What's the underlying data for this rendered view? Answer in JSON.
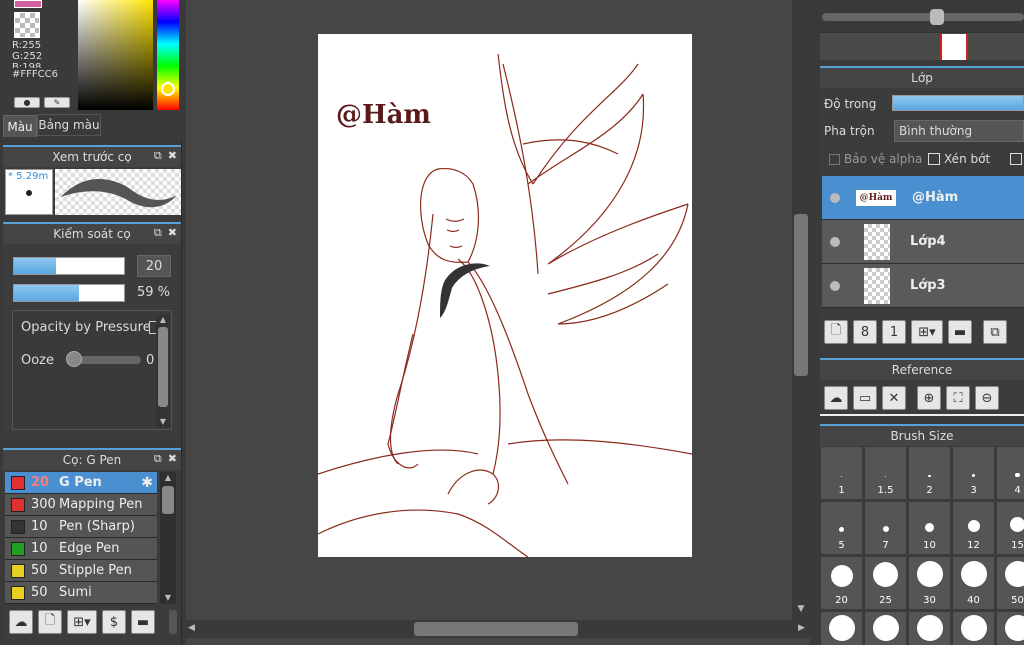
{
  "color": {
    "r": "R:255",
    "g": "G:252",
    "b": "B:198",
    "hex": "#FFFCC6",
    "tab_color": "Màu",
    "tab_palette": "Bảng màu"
  },
  "brush_preview": {
    "title": "Xem trước cọ",
    "size": "* 5.29m"
  },
  "brush_control": {
    "title": "Kiểm soát cọ",
    "size_value": "20",
    "size_fill": 0.38,
    "opacity_value": "59 %",
    "opacity_fill": 0.59,
    "pressure_label": "Opacity by Pressure",
    "ooze_label": "Ooze",
    "ooze_value": "0"
  },
  "brushes": {
    "title": "Cọ: G Pen",
    "items": [
      {
        "size": "20",
        "name": "G Pen",
        "color": "#e03030",
        "selected": true
      },
      {
        "size": "300",
        "name": "Mapping Pen",
        "color": "#e03030"
      },
      {
        "size": "10",
        "name": "Pen (Sharp)",
        "color": "#333333"
      },
      {
        "size": "10",
        "name": "Edge Pen",
        "color": "#20a020"
      },
      {
        "size": "50",
        "name": "Stipple Pen",
        "color": "#e8d020"
      },
      {
        "size": "50",
        "name": "Sumi",
        "color": "#e8d020"
      }
    ]
  },
  "canvas": {
    "watermark": "@Hàm"
  },
  "layers": {
    "title": "Lớp",
    "opacity_label": "Độ trong",
    "blend_label": "Pha trộn",
    "blend_value": "Bình thường",
    "protect_alpha": "Bảo vệ alpha",
    "clipping": "Xén bớt",
    "items": [
      {
        "name": "@Hàm",
        "selected": true,
        "thumb_text": "@Hàm"
      },
      {
        "name": "Lớp4"
      },
      {
        "name": "Lớp3"
      }
    ]
  },
  "reference": {
    "title": "Reference"
  },
  "brush_size": {
    "title": "Brush Size",
    "sizes": [
      "1",
      "1.5",
      "2",
      "3",
      "4",
      "5",
      "7",
      "10",
      "12",
      "15",
      "20",
      "25",
      "30",
      "40",
      "50"
    ]
  }
}
